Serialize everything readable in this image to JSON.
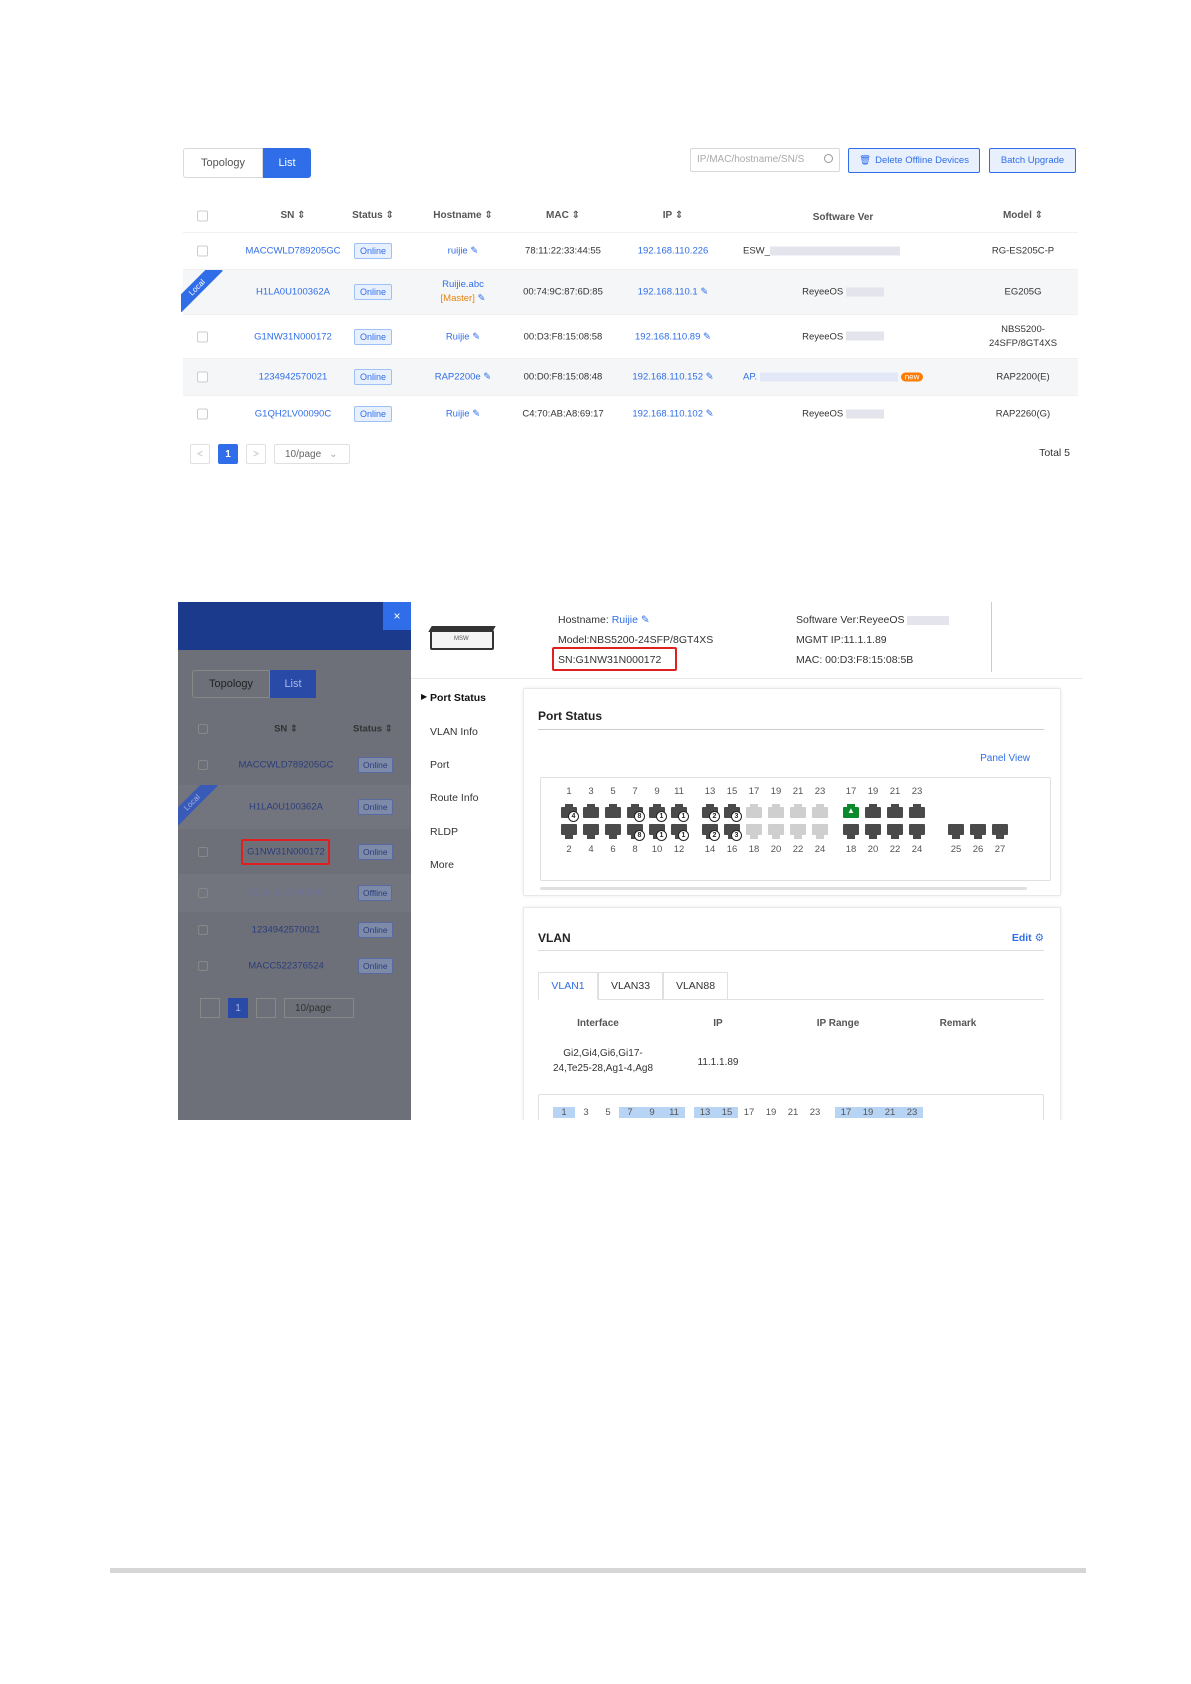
{
  "list_view": {
    "view_tabs": [
      "Topology",
      "List"
    ],
    "search_placeholder": "IP/MAC/hostname/SN/S",
    "delete_offline_label": "Delete Offline Devices",
    "batch_upgrade_label": "Batch Upgrade",
    "columns": [
      "SN",
      "Status",
      "Hostname",
      "MAC",
      "IP",
      "Software Ver",
      "Model"
    ],
    "local_ribbon": "Local",
    "rows": [
      {
        "sn": "MACCWLD789205GC",
        "status": "Online",
        "hostname": "ruijie",
        "hostname_sub": "",
        "mac": "78:11:22:33:44:55",
        "ip": "192.168.110.226",
        "software": "ESW_",
        "model": "RG-ES205C-P",
        "model_sub": ""
      },
      {
        "sn": "H1LA0U100362A",
        "status": "Online",
        "hostname": "Ruijie.abc",
        "hostname_sub": "[Master]",
        "mac": "00:74:9C:87:6D:85",
        "ip": "192.168.110.1",
        "software": "ReyeeOS",
        "model": "EG205G",
        "model_sub": ""
      },
      {
        "sn": "G1NW31N000172",
        "status": "Online",
        "hostname": "Ruijie",
        "hostname_sub": "",
        "mac": "00:D3:F8:15:08:58",
        "ip": "192.168.110.89",
        "software": "ReyeeOS",
        "model": "NBS5200-",
        "model_sub": "24SFP/8GT4XS"
      },
      {
        "sn": "1234942570021",
        "status": "Online",
        "hostname": "RAP2200e",
        "hostname_sub": "",
        "mac": "00:D0:F8:15:08:48",
        "ip": "192.168.110.152",
        "software": "AP.",
        "model": "RAP2200(E)",
        "model_sub": ""
      },
      {
        "sn": "G1QH2LV00090C",
        "status": "Online",
        "hostname": "Ruijie",
        "hostname_sub": "",
        "mac": "C4:70:AB:A8:69:17",
        "ip": "192.168.110.102",
        "software": "ReyeeOS",
        "model": "RAP2260(G)",
        "model_sub": ""
      }
    ],
    "new_badge": "new",
    "pager": {
      "prev": "<",
      "page": "1",
      "next": ">",
      "page_size": "10/page",
      "total": "Total 5"
    }
  },
  "detail_view": {
    "left_panel": {
      "view_tabs": [
        "Topology",
        "List"
      ],
      "columns": [
        "SN",
        "Status"
      ],
      "local_ribbon": "Local",
      "rows": [
        {
          "sn": "MACCWLD789205GC",
          "status": "Online"
        },
        {
          "sn": "H1LA0U100362A",
          "status": "Online"
        },
        {
          "sn": "G1NW31N000172",
          "status": "Online"
        },
        {
          "sn": "G1QH2LV00090C",
          "status": "Offline"
        },
        {
          "sn": "1234942570021",
          "status": "Online"
        },
        {
          "sn": "MACC522376524",
          "status": "Online"
        }
      ],
      "pager": {
        "page": "1",
        "page_size": "10/page"
      },
      "close": "×"
    },
    "device": {
      "hostname_label": "Hostname:",
      "hostname": "Ruijie",
      "model": "Model:NBS5200-24SFP/8GT4XS",
      "sn": "SN:G1NW31N000172",
      "software": "Software Ver:ReyeeOS",
      "mgmt_ip": "MGMT IP:11.1.1.89",
      "mac": "MAC: 00:D3:F8:15:08:5B",
      "image_label": "MSW"
    },
    "menu": [
      "Port Status",
      "VLAN Info",
      "Port",
      "Route Info",
      "RLDP",
      "More"
    ],
    "port_status": {
      "title": "Port Status",
      "panel_view": "Panel View",
      "top_numbers": [
        "1",
        "3",
        "5",
        "7",
        "9",
        "11",
        "13",
        "15",
        "17",
        "19",
        "21",
        "23",
        "17",
        "19",
        "21",
        "23"
      ],
      "bottom_numbers": [
        "2",
        "4",
        "6",
        "8",
        "10",
        "12",
        "14",
        "16",
        "18",
        "20",
        "22",
        "24",
        "18",
        "20",
        "22",
        "24",
        "25",
        "26",
        "27"
      ],
      "top_badges": [
        "4",
        "8",
        "1",
        "1",
        "2",
        "3"
      ],
      "bottom_badges": [
        "8",
        "1",
        "1",
        "2",
        "3"
      ]
    },
    "vlan": {
      "title": "VLAN",
      "edit": "Edit",
      "tabs": [
        "VLAN1",
        "VLAN33",
        "VLAN88"
      ],
      "columns": [
        "Interface",
        "IP",
        "IP Range",
        "Remark"
      ],
      "row": {
        "interface_1": "Gi2,Gi4,Gi6,Gi17-",
        "interface_2": "24,Te25-28,Ag1-4,Ag8",
        "ip": "11.1.1.89",
        "ip_range": "",
        "remark": ""
      },
      "bottom_numbers": [
        "1",
        "3",
        "5",
        "7",
        "9",
        "11",
        "13",
        "15",
        "17",
        "19",
        "21",
        "23",
        "17",
        "19",
        "21",
        "23"
      ]
    }
  }
}
